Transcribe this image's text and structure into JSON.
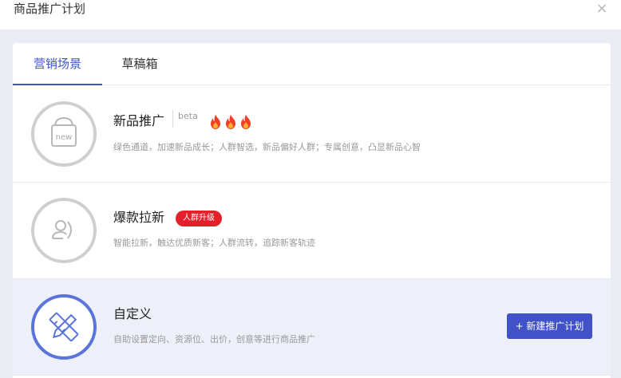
{
  "dialog": {
    "title": "商品推广计划",
    "close_symbol": "×"
  },
  "tabs": [
    {
      "label": "营销场景",
      "active": true
    },
    {
      "label": "草稿箱",
      "active": false
    }
  ],
  "scenes": [
    {
      "title": "新品推广",
      "tag": "beta",
      "hot_icons": [
        "fire-icon",
        "fire-icon",
        "fire-icon"
      ],
      "icon": "new-basket-icon",
      "icon_text": "new",
      "description": "绿色通道，加速新品成长；人群智选，新品偏好人群；专属创意，凸显新品心智"
    },
    {
      "title": "爆款拉新",
      "badge": "人群升级",
      "icon": "user-plus-icon",
      "description": "智能拉新，触达优质新客；人群流转，追踪新客轨迹"
    },
    {
      "title": "自定义",
      "icon": "ruler-pencil-icon",
      "description": "自助设置定向、资源位、出价，创意等进行商品推广",
      "selected": true,
      "action_label": "+ 新建推广计划"
    }
  ],
  "colors": {
    "accent": "#3e55c8",
    "button": "#4052c6",
    "badge_red": "#e4202b",
    "selected_bg": "#eef0f9"
  }
}
